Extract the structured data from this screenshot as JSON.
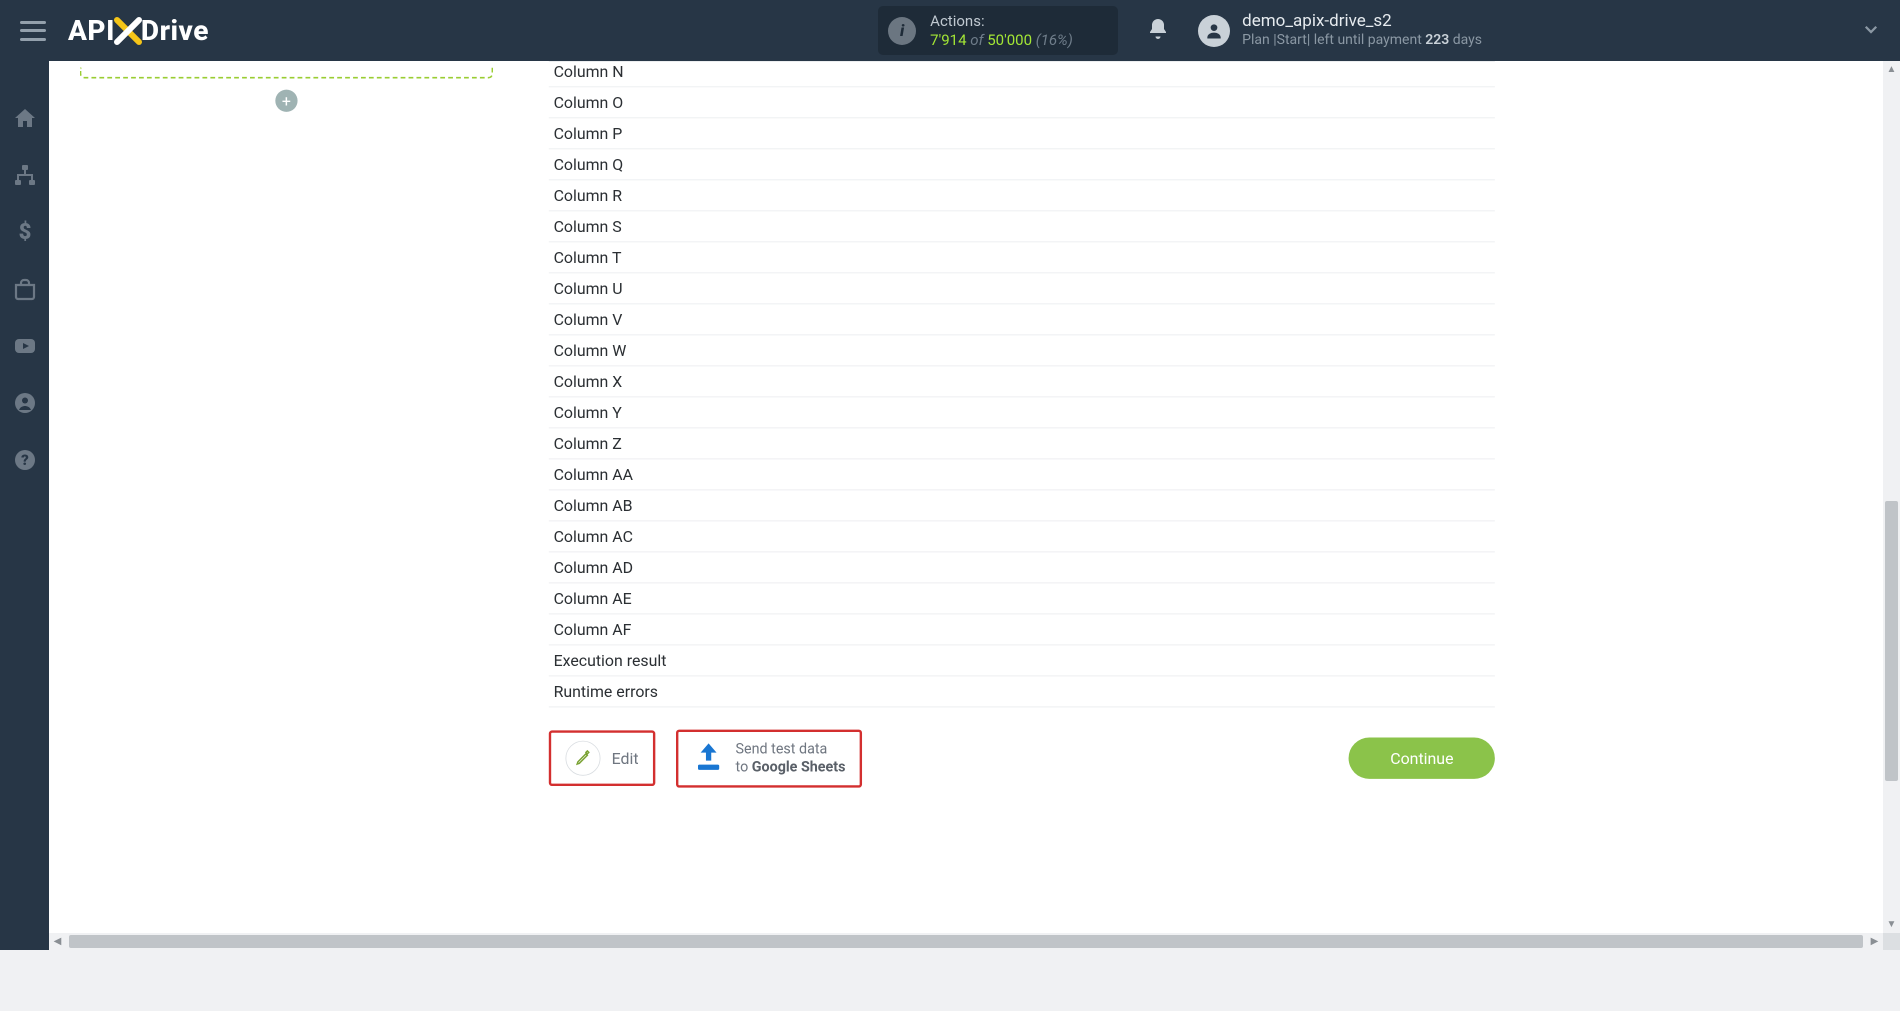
{
  "header": {
    "logo_a": "API",
    "logo_b": "Drive",
    "actions": {
      "label": "Actions:",
      "used": "7'914",
      "of": " of ",
      "limit": "50'000",
      "pct": " (16%)"
    },
    "user": {
      "name": "demo_apix-drive_s2",
      "plan_prefix": "Plan |Start| left until payment ",
      "days": "223",
      "days_suffix": " days"
    }
  },
  "sidebar": {
    "items": [
      {
        "name": "home"
      },
      {
        "name": "connections"
      },
      {
        "name": "billing"
      },
      {
        "name": "toolbox"
      },
      {
        "name": "video"
      },
      {
        "name": "account"
      },
      {
        "name": "help"
      }
    ]
  },
  "left": {
    "add_label": "+"
  },
  "rows": [
    "Column N",
    "Column O",
    "Column P",
    "Column Q",
    "Column R",
    "Column S",
    "Column T",
    "Column U",
    "Column V",
    "Column W",
    "Column X",
    "Column Y",
    "Column Z",
    "Column AA",
    "Column AB",
    "Column AC",
    "Column AD",
    "Column AE",
    "Column AF",
    "Execution result",
    "Runtime errors"
  ],
  "buttons": {
    "edit": "Edit",
    "send_line1": "Send test data",
    "send_line2_a": "to ",
    "send_line2_b": "Google Sheets",
    "continue": "Continue"
  }
}
